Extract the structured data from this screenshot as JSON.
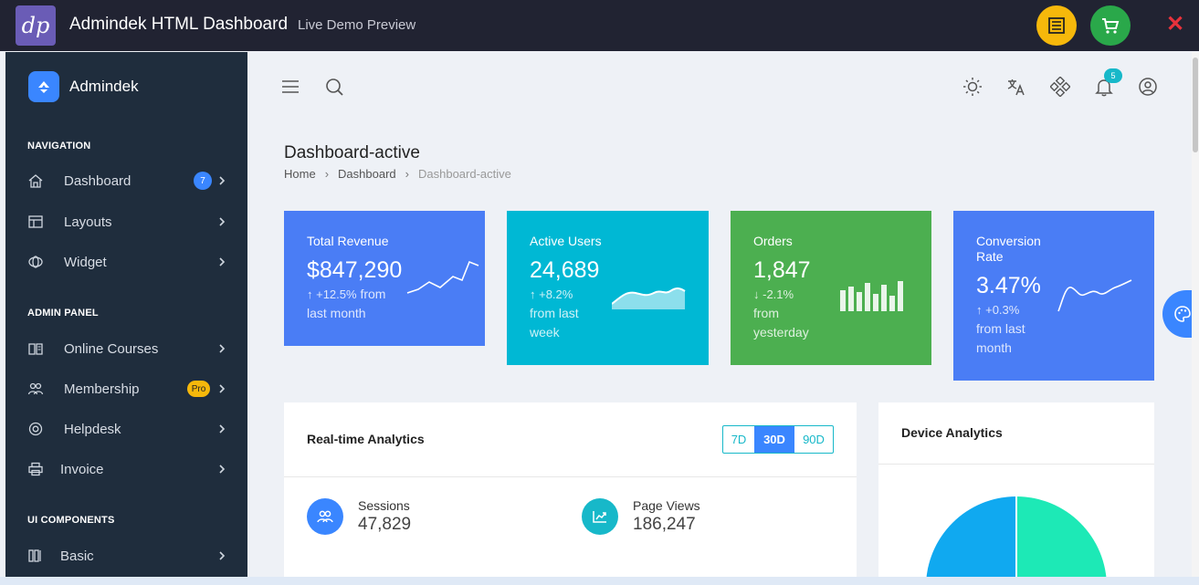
{
  "demo_bar": {
    "logo": "dp",
    "title": "Admindek HTML Dashboard",
    "subtitle": "Live Demo Preview",
    "close": "✕"
  },
  "sidebar": {
    "brand": "Admindek",
    "sections": [
      {
        "title": "NAVIGATION",
        "items": [
          {
            "label": "Dashboard",
            "badge": "7",
            "icon": "home-icon"
          },
          {
            "label": "Layouts",
            "icon": "layout-icon"
          },
          {
            "label": "Widget",
            "icon": "widget-icon"
          }
        ]
      },
      {
        "title": "ADMIN PANEL",
        "items": [
          {
            "label": "Online Courses",
            "icon": "book-icon"
          },
          {
            "label": "Membership",
            "badge": "Pro",
            "icon": "users-icon"
          },
          {
            "label": "Helpdesk",
            "icon": "lifebuoy-icon"
          },
          {
            "label": "Invoice",
            "icon": "printer-icon"
          }
        ]
      },
      {
        "title": "UI COMPONENTS",
        "items": [
          {
            "label": "Basic",
            "icon": "basic-icon"
          }
        ]
      }
    ]
  },
  "header": {
    "notification_count": "5"
  },
  "page": {
    "title": "Dashboard-active",
    "breadcrumb": [
      "Home",
      "Dashboard",
      "Dashboard-active"
    ]
  },
  "stats": [
    {
      "title": "Total Revenue",
      "value": "$847,290",
      "change": "↑  +12.5%",
      "note1": "from",
      "note2": "last month",
      "color": "#4a7df5"
    },
    {
      "title": "Active Users",
      "value": "24,689",
      "change": "↑  +8.2%",
      "note1": "from last",
      "note2": "week",
      "color": "#00b8d4"
    },
    {
      "title": "Orders",
      "value": "1,847",
      "change": "↓  -2.1%",
      "note1": "from",
      "note2": "yesterday",
      "color": "#4caf50"
    },
    {
      "title": "Conversion",
      "title2": "Rate",
      "value": "3.47%",
      "change": "↑  +0.3%",
      "note1": "from last",
      "note2": "month",
      "color": "#4a7df5"
    }
  ],
  "analytics": {
    "title": "Real-time Analytics",
    "ranges": [
      "7D",
      "30D",
      "90D"
    ],
    "selected_range": "30D",
    "metrics": [
      {
        "label": "Sessions",
        "value": "47,829",
        "icon": "users-icon",
        "color": "#3a86ff"
      },
      {
        "label": "Page Views",
        "value": "186,247",
        "icon": "trend-icon",
        "color": "#17b8c9"
      }
    ]
  },
  "device": {
    "title": "Device Analytics",
    "colors": [
      "#10a9f0",
      "#1de9b6"
    ]
  }
}
